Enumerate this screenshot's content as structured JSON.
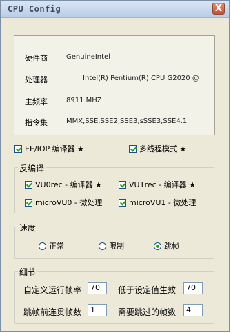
{
  "window": {
    "title": "CPU Config",
    "close_glyph": "X"
  },
  "info": {
    "vendor_label": "硬件商",
    "vendor_value": "GenuineIntel",
    "cpu_label": "处理器",
    "cpu_value": "Intel(R) Pentium(R) CPU G2020 @",
    "freq_label": "主频率",
    "freq_value": "8911 MHZ",
    "isa_label": "指令集",
    "isa_value": "MMX,SSE,SSE2,SSE3,sSSE3,SSE4.1"
  },
  "options": {
    "ee_iop_label": "EE/IOP 编译器 ★",
    "ee_iop_checked": true,
    "multithread_label": "多线程模式 ★",
    "multithread_checked": true
  },
  "decompiler": {
    "title": "反编译",
    "vu0rec_label": "VU0rec - 编译器 ★",
    "vu0rec_checked": true,
    "vu1rec_label": "VU1rec - 编译器 ★",
    "vu1rec_checked": true,
    "microvu0_label": "microVU0 - 微处理",
    "microvu0_checked": true,
    "microvu1_label": "microVU1 - 微处理",
    "microvu1_checked": true
  },
  "speed": {
    "title": "速度",
    "options": [
      "正常",
      "限制",
      "跳帧"
    ],
    "selected": "跳帧"
  },
  "details": {
    "title": "细节",
    "custom_fps_label": "自定义运行帧率",
    "custom_fps_value": "70",
    "below_effect_label": "低于设定值生效",
    "below_effect_value": "70",
    "consecutive_skip_label": "跳帧前连贯帧数",
    "consecutive_skip_value": "1",
    "skip_frames_label": "需要跳过的帧数",
    "skip_frames_value": "4"
  },
  "colors": {
    "check_green": "#21a121",
    "titlebar": "#c6d6ec",
    "close_red": "#c9513a"
  }
}
